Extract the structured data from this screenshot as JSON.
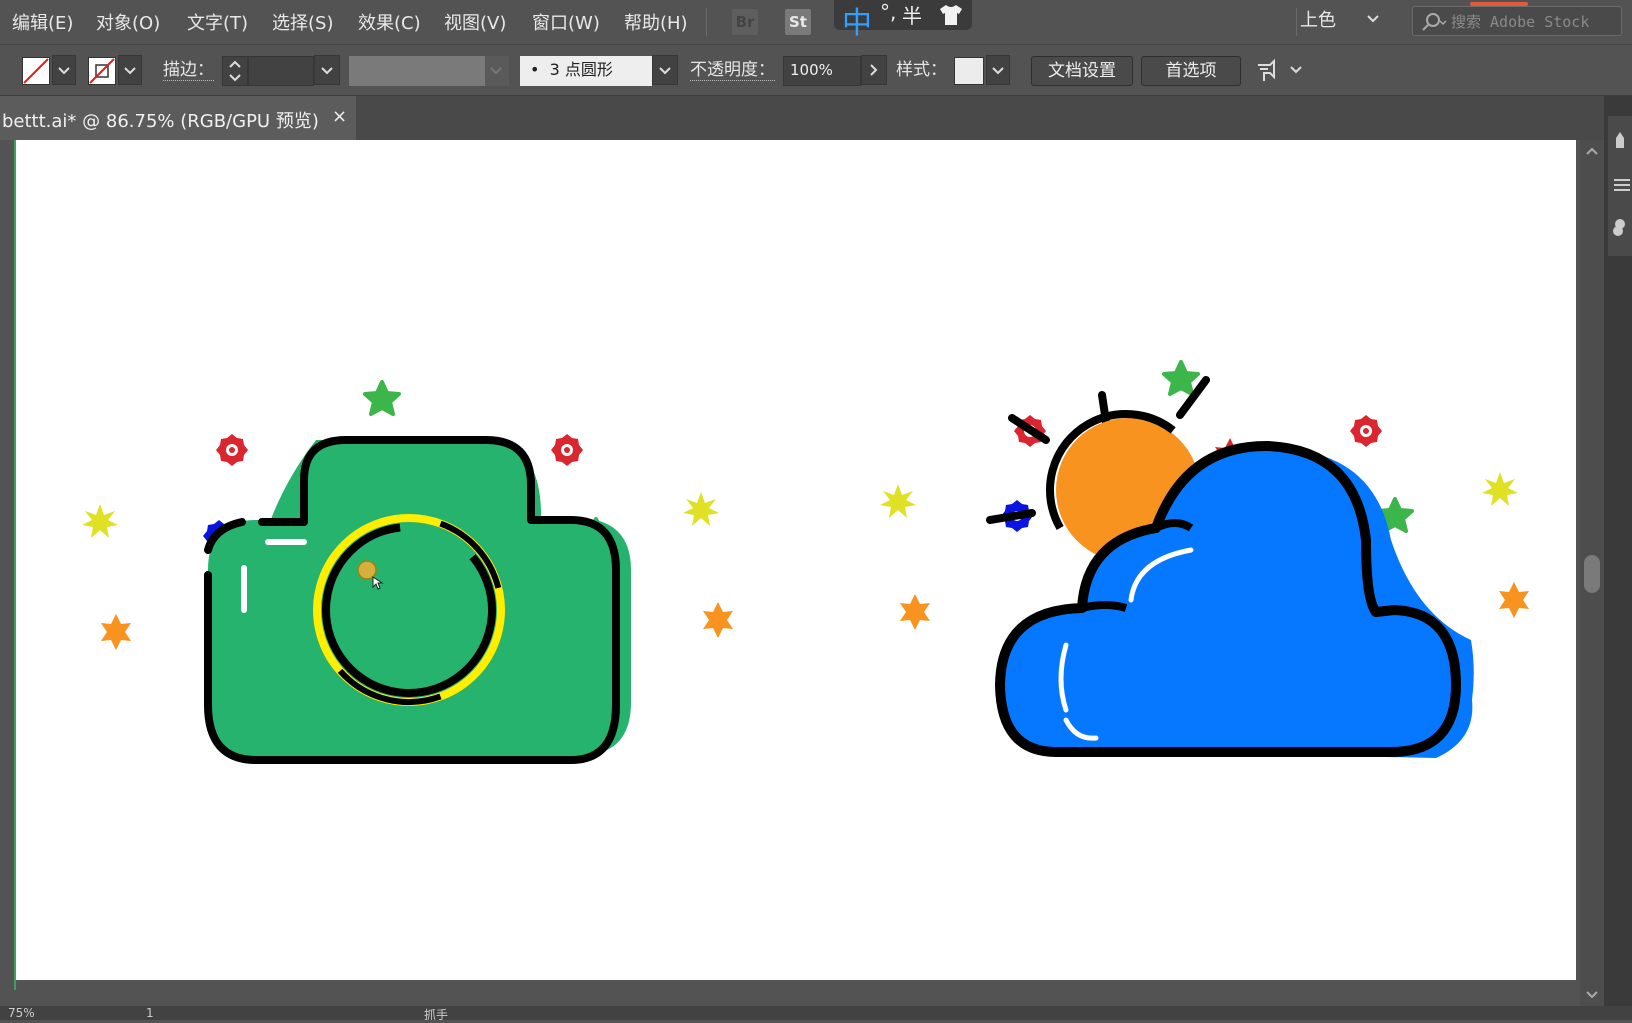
{
  "menu": {
    "items": [
      "编辑(E)",
      "对象(O)",
      "文字(T)",
      "选择(S)",
      "效果(C)",
      "视图(V)",
      "窗口(W)",
      "帮助(H)"
    ],
    "bridge_badge": "Br",
    "stock_badge": "St"
  },
  "ime": {
    "lang": "中",
    "punct": "°,",
    "width": "半"
  },
  "workspace": {
    "label": "上色"
  },
  "search": {
    "placeholder": "搜索 Adobe Stock"
  },
  "control": {
    "stroke_label": "描边：",
    "brush_label": "3 点圆形",
    "brush_bullet": "•",
    "opacity_label": "不透明度：",
    "opacity_value": "100%",
    "style_label": "样式：",
    "doc_setup_button": "文档设置",
    "preferences_button": "首选项"
  },
  "document": {
    "tab_title": "bettt.ai* @ 86.75% (RGB/GPU 预览)",
    "close_glyph": "×"
  },
  "status": {
    "zoom": "75%",
    "page": "1",
    "tool": "抓手"
  },
  "colors": {
    "camera_green": "#25b36e",
    "cloud_blue": "#0578ff",
    "sun_orange": "#f7931e",
    "lens_yellow": "#ffee00",
    "star_yellow": "#e0e024",
    "star_red": "#d9262f",
    "star_green": "#3cb54a",
    "star_orange": "#f7931e",
    "gear_blue": "#0a14e0",
    "accent_red": "#e25b3a"
  }
}
